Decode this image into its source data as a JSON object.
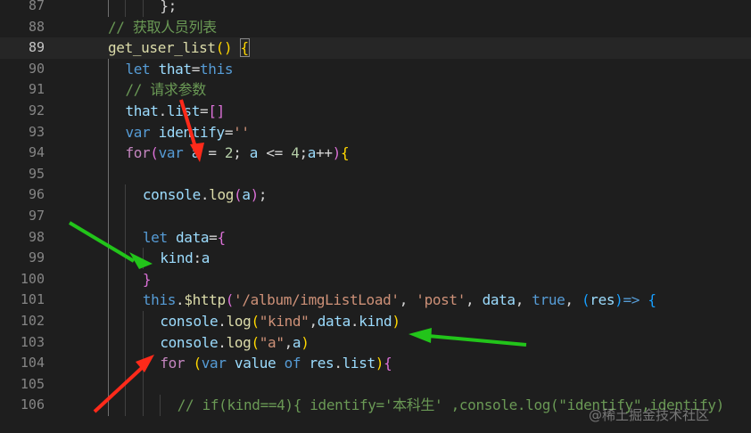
{
  "editor": {
    "current_line": 89,
    "lines": [
      {
        "num": 87,
        "indent": 6,
        "tokens": [
          {
            "t": "};",
            "c": "tok-op"
          }
        ]
      },
      {
        "num": 88,
        "indent": 0,
        "tokens": []
      },
      {
        "num": 88,
        "indent": 0,
        "tokens": [
          {
            "t": "// 获取人员列表",
            "c": "tok-cmt"
          }
        ]
      },
      {
        "num": 89,
        "indent": 0,
        "tokens": [
          {
            "t": "get_user_list",
            "c": "tok-fn"
          },
          {
            "t": "() ",
            "c": "tok-b1"
          },
          {
            "t": "{",
            "c": "tok-b1 bracket-box"
          }
        ]
      },
      {
        "num": 90,
        "indent": 2,
        "tokens": [
          {
            "t": "let ",
            "c": "tok-kw"
          },
          {
            "t": "that",
            "c": "tok-var"
          },
          {
            "t": "=",
            "c": "tok-op"
          },
          {
            "t": "this",
            "c": "tok-kw"
          }
        ]
      },
      {
        "num": 91,
        "indent": 2,
        "tokens": [
          {
            "t": "// 请求参数",
            "c": "tok-cmt"
          }
        ]
      },
      {
        "num": 92,
        "indent": 2,
        "tokens": [
          {
            "t": "that",
            "c": "tok-var"
          },
          {
            "t": ".",
            "c": "tok-op"
          },
          {
            "t": "list",
            "c": "tok-var"
          },
          {
            "t": "=",
            "c": "tok-op"
          },
          {
            "t": "[]",
            "c": "tok-b2"
          }
        ]
      },
      {
        "num": 93,
        "indent": 2,
        "tokens": [
          {
            "t": "var ",
            "c": "tok-kw"
          },
          {
            "t": "identify",
            "c": "tok-var"
          },
          {
            "t": "=",
            "c": "tok-op"
          },
          {
            "t": "''",
            "c": "tok-str"
          }
        ]
      },
      {
        "num": 94,
        "indent": 2,
        "tokens": [
          {
            "t": "for",
            "c": "tok-ctl"
          },
          {
            "t": "(",
            "c": "tok-b2"
          },
          {
            "t": "var ",
            "c": "tok-kw"
          },
          {
            "t": "a",
            "c": "tok-var"
          },
          {
            "t": " = ",
            "c": "tok-op"
          },
          {
            "t": "2",
            "c": "tok-num"
          },
          {
            "t": "; ",
            "c": "tok-op"
          },
          {
            "t": "a",
            "c": "tok-var"
          },
          {
            "t": " <= ",
            "c": "tok-op"
          },
          {
            "t": "4",
            "c": "tok-num"
          },
          {
            "t": ";",
            "c": "tok-op"
          },
          {
            "t": "a",
            "c": "tok-var"
          },
          {
            "t": "++",
            "c": "tok-op"
          },
          {
            "t": ")",
            "c": "tok-b2"
          },
          {
            "t": "{",
            "c": "tok-b1"
          }
        ]
      },
      {
        "num": 95,
        "indent": 2,
        "tokens": []
      },
      {
        "num": 96,
        "indent": 4,
        "tokens": [
          {
            "t": "console",
            "c": "tok-var"
          },
          {
            "t": ".",
            "c": "tok-op"
          },
          {
            "t": "log",
            "c": "tok-fn"
          },
          {
            "t": "(",
            "c": "tok-b2"
          },
          {
            "t": "a",
            "c": "tok-var"
          },
          {
            "t": ")",
            "c": "tok-b2"
          },
          {
            "t": ";",
            "c": "tok-op"
          }
        ]
      },
      {
        "num": 97,
        "indent": 4,
        "tokens": []
      },
      {
        "num": 98,
        "indent": 4,
        "tokens": [
          {
            "t": "let ",
            "c": "tok-kw"
          },
          {
            "t": "data",
            "c": "tok-var"
          },
          {
            "t": "=",
            "c": "tok-op"
          },
          {
            "t": "{",
            "c": "tok-b2"
          }
        ]
      },
      {
        "num": 99,
        "indent": 6,
        "tokens": [
          {
            "t": "kind",
            "c": "tok-var"
          },
          {
            "t": ":",
            "c": "tok-op"
          },
          {
            "t": "a",
            "c": "tok-var"
          }
        ]
      },
      {
        "num": 100,
        "indent": 4,
        "tokens": [
          {
            "t": "}",
            "c": "tok-b2"
          }
        ]
      },
      {
        "num": 101,
        "indent": 4,
        "tokens": [
          {
            "t": "this",
            "c": "tok-kw"
          },
          {
            "t": ".",
            "c": "tok-op"
          },
          {
            "t": "$http",
            "c": "tok-fn"
          },
          {
            "t": "(",
            "c": "tok-b2"
          },
          {
            "t": "'/album/imgListLoad'",
            "c": "tok-str"
          },
          {
            "t": ", ",
            "c": "tok-op"
          },
          {
            "t": "'post'",
            "c": "tok-str"
          },
          {
            "t": ", ",
            "c": "tok-op"
          },
          {
            "t": "data",
            "c": "tok-var"
          },
          {
            "t": ", ",
            "c": "tok-op"
          },
          {
            "t": "true",
            "c": "tok-kw"
          },
          {
            "t": ", ",
            "c": "tok-op"
          },
          {
            "t": "(",
            "c": "tok-b3"
          },
          {
            "t": "res",
            "c": "tok-var"
          },
          {
            "t": ")",
            "c": "tok-b3"
          },
          {
            "t": "=> ",
            "c": "tok-kw"
          },
          {
            "t": "{",
            "c": "tok-b3"
          }
        ]
      },
      {
        "num": 102,
        "indent": 6,
        "tokens": [
          {
            "t": "console",
            "c": "tok-var"
          },
          {
            "t": ".",
            "c": "tok-op"
          },
          {
            "t": "log",
            "c": "tok-fn"
          },
          {
            "t": "(",
            "c": "tok-b1"
          },
          {
            "t": "\"kind\"",
            "c": "tok-str"
          },
          {
            "t": ",",
            "c": "tok-op"
          },
          {
            "t": "data",
            "c": "tok-var"
          },
          {
            "t": ".",
            "c": "tok-op"
          },
          {
            "t": "kind",
            "c": "tok-var"
          },
          {
            "t": ")",
            "c": "tok-b1"
          }
        ]
      },
      {
        "num": 103,
        "indent": 6,
        "tokens": [
          {
            "t": "console",
            "c": "tok-var"
          },
          {
            "t": ".",
            "c": "tok-op"
          },
          {
            "t": "log",
            "c": "tok-fn"
          },
          {
            "t": "(",
            "c": "tok-b1"
          },
          {
            "t": "\"a\"",
            "c": "tok-str"
          },
          {
            "t": ",",
            "c": "tok-op"
          },
          {
            "t": "a",
            "c": "tok-var"
          },
          {
            "t": ")",
            "c": "tok-b1"
          }
        ]
      },
      {
        "num": 104,
        "indent": 6,
        "tokens": [
          {
            "t": "for",
            "c": "tok-ctl"
          },
          {
            "t": " ",
            "c": "tok-op"
          },
          {
            "t": "(",
            "c": "tok-b1"
          },
          {
            "t": "var ",
            "c": "tok-kw"
          },
          {
            "t": "value ",
            "c": "tok-var"
          },
          {
            "t": "of ",
            "c": "tok-kw"
          },
          {
            "t": "res",
            "c": "tok-var"
          },
          {
            "t": ".",
            "c": "tok-op"
          },
          {
            "t": "list",
            "c": "tok-var"
          },
          {
            "t": ")",
            "c": "tok-b1"
          },
          {
            "t": "{",
            "c": "tok-b2"
          }
        ]
      },
      {
        "num": 105,
        "indent": 6,
        "tokens": []
      },
      {
        "num": 106,
        "indent": 8,
        "tokens": [
          {
            "t": "// if(kind==4){ identify='本科生' ,console.log(\"identify\",identify)",
            "c": "tok-cmt"
          }
        ]
      }
    ]
  },
  "watermark": "@稀土掘金技术社区",
  "annotation_colors": {
    "red": "#ff2a1a",
    "green": "#22c41a"
  }
}
